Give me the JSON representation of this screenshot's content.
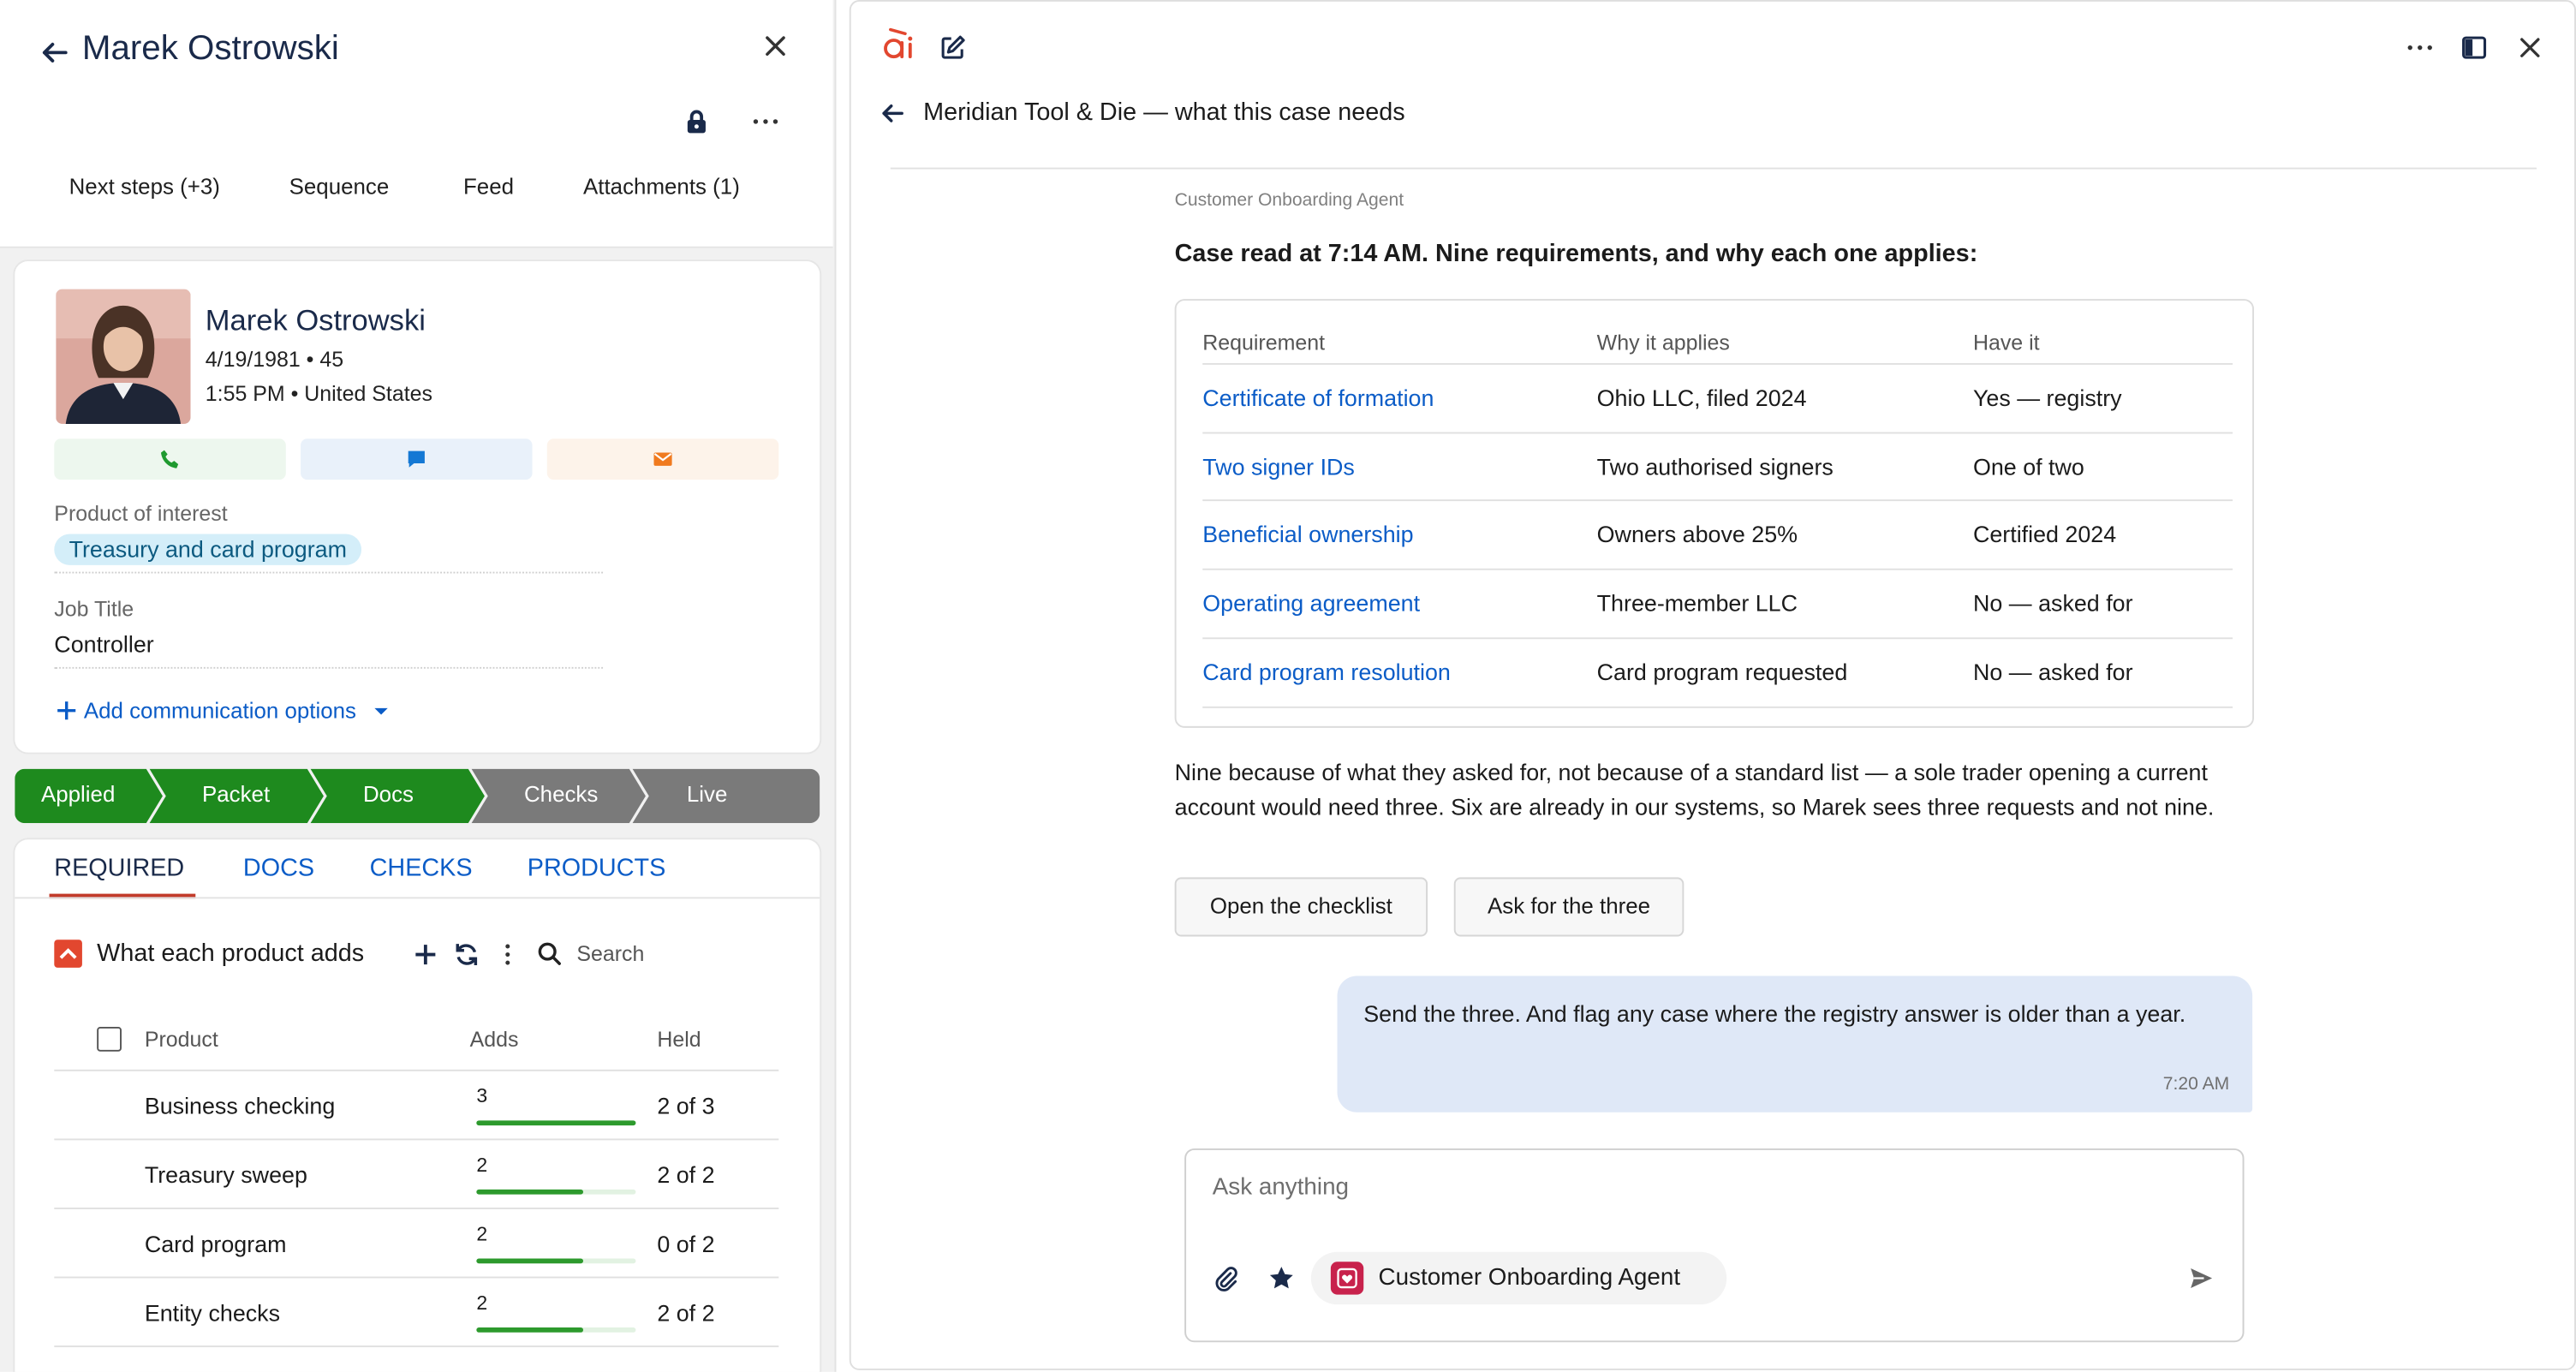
{
  "contact_panel": {
    "title": "Marek Ostrowski",
    "tabs": [
      "Next steps (+3)",
      "Sequence",
      "Feed",
      "Attachments (1)"
    ],
    "profile": {
      "name": "Marek Ostrowski",
      "birth_line": "4/19/1981 • 45",
      "time_line": "1:55 PM • United States"
    },
    "actions": [
      {
        "icon": "phone-icon",
        "color": "#1f9a2f"
      },
      {
        "icon": "chat-icon",
        "color": "#1478d4"
      },
      {
        "icon": "mail-icon",
        "color": "#f07a1f"
      }
    ],
    "product_label": "Product of interest",
    "product_value": "Treasury and card program",
    "job_label": "Job Title",
    "job_value": "Controller",
    "add_comm": "Add communication options",
    "stages": [
      {
        "label": "Applied",
        "done": true
      },
      {
        "label": "Packet",
        "done": true
      },
      {
        "label": "Docs",
        "done": true
      },
      {
        "label": "Checks",
        "done": false
      },
      {
        "label": "Live",
        "done": false
      }
    ],
    "sub_tabs": [
      "REQUIRED",
      "DOCS",
      "CHECKS",
      "PRODUCTS"
    ],
    "section_title": "What each product adds",
    "search_placeholder": "Search",
    "table": {
      "headers": [
        "Product",
        "Adds",
        "Held"
      ],
      "rows": [
        {
          "product": "Business checking",
          "adds": "3",
          "held": "2 of 3",
          "fill": 1.0
        },
        {
          "product": "Treasury sweep",
          "adds": "2",
          "held": "2 of 2",
          "fill": 0.67
        },
        {
          "product": "Card program",
          "adds": "2",
          "held": "0 of 2",
          "fill": 0.67
        },
        {
          "product": "Entity checks",
          "adds": "2",
          "held": "2 of 2",
          "fill": 0.67
        }
      ]
    }
  },
  "assistant": {
    "title": "Meridian Tool & Die — what this case needs",
    "agent_label": "Customer Onboarding Agent",
    "lead": "Case read at 7:14 AM. Nine requirements, and why each one applies:",
    "table": {
      "headers": [
        "Requirement",
        "Why it applies",
        "Have it"
      ],
      "rows": [
        {
          "req": "Certificate of formation",
          "why": "Ohio LLC, filed 2024",
          "have": "Yes — registry"
        },
        {
          "req": "Two signer IDs",
          "why": "Two authorised signers",
          "have": "One of two"
        },
        {
          "req": "Beneficial ownership",
          "why": "Owners above 25%",
          "have": "Certified 2024"
        },
        {
          "req": "Operating agreement",
          "why": "Three-member LLC",
          "have": "No — asked for"
        },
        {
          "req": "Card program resolution",
          "why": "Card program requested",
          "have": "No — asked for"
        }
      ]
    },
    "paragraph": "Nine because of what they asked for, not because of a standard list — a sole trader opening a current account would need three. Six are already in our systems, so Marek sees three requests and not nine.",
    "buttons": [
      "Open the checklist",
      "Ask for the three"
    ],
    "user_message": "Send the three. And flag any case where the registry answer is older than a year.",
    "user_time": "7:20 AM",
    "composer_placeholder": "Ask anything",
    "agent_chip": "Customer Onboarding Agent",
    "brand_color": "#e2472f",
    "link_color": "#0b5cc7",
    "stage_done_color": "#1e8a1e",
    "stage_todo_color": "#7a7a7a"
  }
}
